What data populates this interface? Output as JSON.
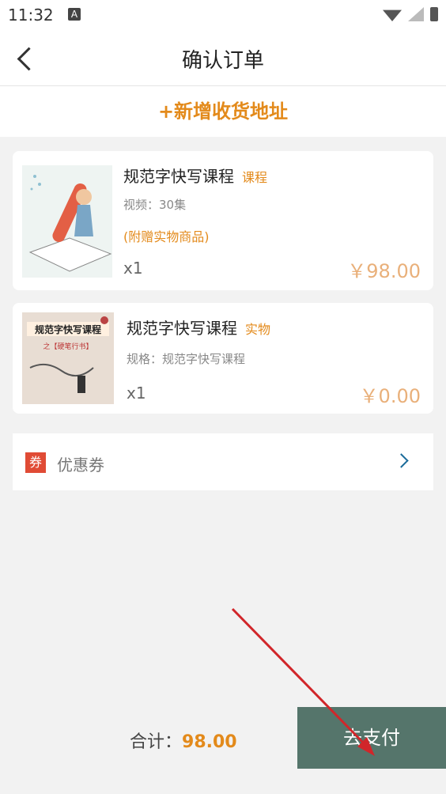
{
  "status": {
    "time": "11:32",
    "a_label": "A"
  },
  "header": {
    "title": "确认订单"
  },
  "address": {
    "add_label": "+新增收货地址"
  },
  "items": [
    {
      "name": "规范字快写课程",
      "tag": "课程",
      "spec": "视频：30集",
      "gift": "(附赠实物商品)",
      "qty": "x1",
      "price": "￥98.00"
    },
    {
      "name": "规范字快写课程",
      "tag": "实物",
      "spec": "规格：规范字快写课程",
      "qty": "x1",
      "price": "￥0.00"
    }
  ],
  "book": {
    "line1": "规范字快写课程",
    "line2": "之【硬笔行书】"
  },
  "coupon": {
    "icon_label": "券",
    "label": "优惠券"
  },
  "footer": {
    "total_label": "合计：",
    "total_value": "98.00",
    "pay_label": "去支付"
  }
}
